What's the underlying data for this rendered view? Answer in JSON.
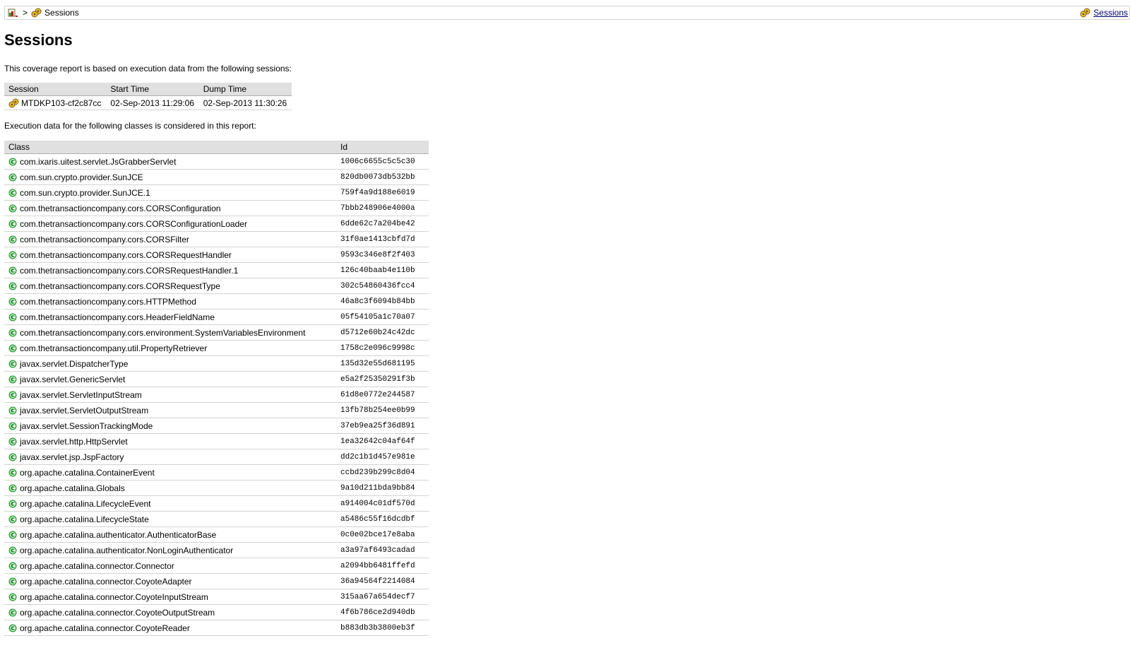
{
  "breadcrumb": {
    "separator": ">",
    "current": "Sessions",
    "right_link": "Sessions"
  },
  "page": {
    "title": "Sessions",
    "intro": "This coverage report is based on execution data from the following sessions:",
    "classes_intro": "Execution data for the following classes is considered in this report:"
  },
  "sessions_table": {
    "headers": [
      "Session",
      "Start Time",
      "Dump Time"
    ],
    "rows": [
      {
        "session": "MTDKP103-cf2c87cc",
        "start": "02-Sep-2013 11:29:06",
        "dump": "02-Sep-2013 11:30:26"
      }
    ]
  },
  "classes_table": {
    "headers": [
      "Class",
      "Id"
    ],
    "rows": [
      {
        "cls": "com.ixaris.uitest.servlet.JsGrabberServlet",
        "id": "1006c6655c5c5c30"
      },
      {
        "cls": "com.sun.crypto.provider.SunJCE",
        "id": "820db0073db532bb"
      },
      {
        "cls": "com.sun.crypto.provider.SunJCE.1",
        "id": "759f4a9d188e6019"
      },
      {
        "cls": "com.thetransactioncompany.cors.CORSConfiguration",
        "id": "7bbb248906e4000a"
      },
      {
        "cls": "com.thetransactioncompany.cors.CORSConfigurationLoader",
        "id": "6dde62c7a204be42"
      },
      {
        "cls": "com.thetransactioncompany.cors.CORSFilter",
        "id": "31f0ae1413cbfd7d"
      },
      {
        "cls": "com.thetransactioncompany.cors.CORSRequestHandler",
        "id": "9593c346e8f2f403"
      },
      {
        "cls": "com.thetransactioncompany.cors.CORSRequestHandler.1",
        "id": "126c40baab4e110b"
      },
      {
        "cls": "com.thetransactioncompany.cors.CORSRequestType",
        "id": "302c54860436fcc4"
      },
      {
        "cls": "com.thetransactioncompany.cors.HTTPMethod",
        "id": "46a8c3f6094b84bb"
      },
      {
        "cls": "com.thetransactioncompany.cors.HeaderFieldName",
        "id": "05f54105a1c70a07"
      },
      {
        "cls": "com.thetransactioncompany.cors.environment.SystemVariablesEnvironment",
        "id": "d5712e60b24c42dc"
      },
      {
        "cls": "com.thetransactioncompany.util.PropertyRetriever",
        "id": "1758c2e096c9998c"
      },
      {
        "cls": "javax.servlet.DispatcherType",
        "id": "135d32e55d681195"
      },
      {
        "cls": "javax.servlet.GenericServlet",
        "id": "e5a2f25350291f3b"
      },
      {
        "cls": "javax.servlet.ServletInputStream",
        "id": "61d8e0772e244587"
      },
      {
        "cls": "javax.servlet.ServletOutputStream",
        "id": "13fb78b254ee0b99"
      },
      {
        "cls": "javax.servlet.SessionTrackingMode",
        "id": "37eb9ea25f36d891"
      },
      {
        "cls": "javax.servlet.http.HttpServlet",
        "id": "1ea32642c04af64f"
      },
      {
        "cls": "javax.servlet.jsp.JspFactory",
        "id": "dd2c1b1d457e981e"
      },
      {
        "cls": "org.apache.catalina.ContainerEvent",
        "id": "ccbd239b299c8d04"
      },
      {
        "cls": "org.apache.catalina.Globals",
        "id": "9a10d211bda9bb84"
      },
      {
        "cls": "org.apache.catalina.LifecycleEvent",
        "id": "a914004c01df570d"
      },
      {
        "cls": "org.apache.catalina.LifecycleState",
        "id": "a5486c55f16dcdbf"
      },
      {
        "cls": "org.apache.catalina.authenticator.AuthenticatorBase",
        "id": "0c0e02bce17e8aba"
      },
      {
        "cls": "org.apache.catalina.authenticator.NonLoginAuthenticator",
        "id": "a3a97af6493cadad"
      },
      {
        "cls": "org.apache.catalina.connector.Connector",
        "id": "a2094bb6481ffefd"
      },
      {
        "cls": "org.apache.catalina.connector.CoyoteAdapter",
        "id": "36a94564f2214084"
      },
      {
        "cls": "org.apache.catalina.connector.CoyoteInputStream",
        "id": "315aa67a654decf7"
      },
      {
        "cls": "org.apache.catalina.connector.CoyoteOutputStream",
        "id": "4f6b786ce2d940db"
      },
      {
        "cls": "org.apache.catalina.connector.CoyoteReader",
        "id": "b883db3b3800eb3f"
      }
    ]
  },
  "colors": {
    "link": "#00006e",
    "header_bg": "#e0e0e0",
    "row_border": "#d6d3ce",
    "class_icon": "#2d9e36"
  },
  "icons": {
    "report": "report-icon",
    "session": "session-icon",
    "class": "class-icon"
  }
}
